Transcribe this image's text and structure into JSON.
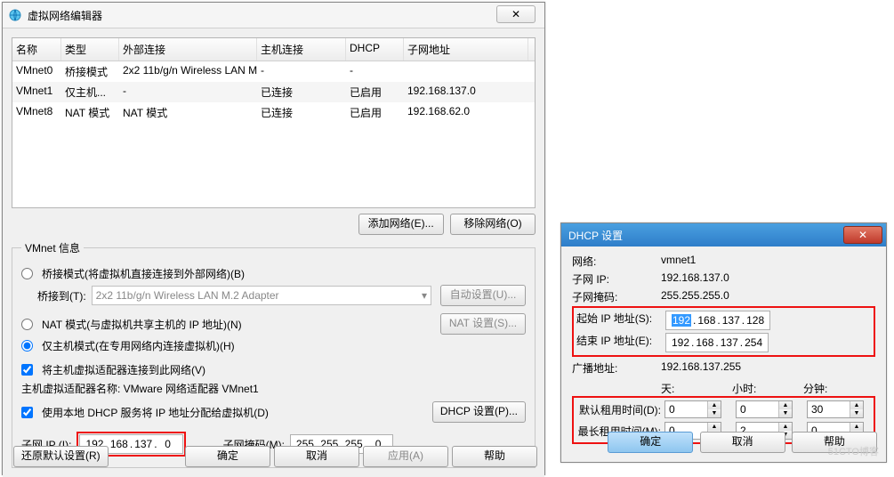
{
  "win1": {
    "title": "虚拟网络编辑器",
    "cols": [
      "名称",
      "类型",
      "外部连接",
      "主机连接",
      "DHCP",
      "子网地址"
    ],
    "rows": [
      {
        "name": "VMnet0",
        "type": "桥接模式",
        "ext": "2x2 11b/g/n Wireless LAN M...",
        "host": "-",
        "dhcp": "-",
        "subnet": ""
      },
      {
        "name": "VMnet1",
        "type": "仅主机...",
        "ext": "-",
        "host": "已连接",
        "dhcp": "已启用",
        "subnet": "192.168.137.0"
      },
      {
        "name": "VMnet8",
        "type": "NAT 模式",
        "ext": "NAT 模式",
        "host": "已连接",
        "dhcp": "已启用",
        "subnet": "192.168.62.0"
      }
    ],
    "addNet": "添加网络(E)...",
    "removeNet": "移除网络(O)",
    "vmnetInfo": "VMnet 信息",
    "optBridge": "桥接模式(将虚拟机直接连接到外部网络)(B)",
    "bridgeToLabel": "桥接到(T):",
    "bridgeTo": "2x2 11b/g/n Wireless LAN M.2 Adapter",
    "autoSet": "自动设置(U)...",
    "optNat": "NAT 模式(与虚拟机共享主机的 IP 地址)(N)",
    "natSet": "NAT 设置(S)...",
    "optHost": "仅主机模式(在专用网络内连接虚拟机)(H)",
    "chkConnect": "将主机虚拟适配器连接到此网络(V)",
    "adapterName": "主机虚拟适配器名称: VMware 网络适配器 VMnet1",
    "chkDhcp": "使用本地 DHCP 服务将 IP 地址分配给虚拟机(D)",
    "dhcpBtn": "DHCP 设置(P)...",
    "subnetIpLabel": "子网 IP (I):",
    "subnetIp": [
      "192",
      "168",
      "137",
      "0"
    ],
    "subnetMaskLabel": "子网掩码(M):",
    "subnetMask": [
      "255",
      "255",
      "255",
      "0"
    ],
    "restore": "还原默认设置(R)",
    "ok": "确定",
    "cancel": "取消",
    "apply": "应用(A)",
    "help": "帮助"
  },
  "win2": {
    "title": "DHCP 设置",
    "labels": {
      "net": "网络:",
      "subnet": "子网 IP:",
      "mask": "子网掩码:",
      "start": "起始 IP 地址(S):",
      "end": "结束 IP 地址(E):",
      "bcast": "广播地址:",
      "days": "天:",
      "hours": "小时:",
      "mins": "分钟:",
      "defLease": "默认租用时间(D):",
      "maxLease": "最长租用时间(M):"
    },
    "net": "vmnet1",
    "subnet": "192.168.137.0",
    "mask": "255.255.255.0",
    "startIp": [
      "192",
      "168",
      "137",
      "128"
    ],
    "endIp": [
      "192",
      "168",
      "137",
      "254"
    ],
    "bcast": "192.168.137.255",
    "defLease": {
      "d": "0",
      "h": "0",
      "m": "30"
    },
    "maxLease": {
      "d": "0",
      "h": "2",
      "m": "0"
    },
    "ok": "确定",
    "cancel": "取消",
    "help": "帮助"
  },
  "watermark": "51CTO博客"
}
